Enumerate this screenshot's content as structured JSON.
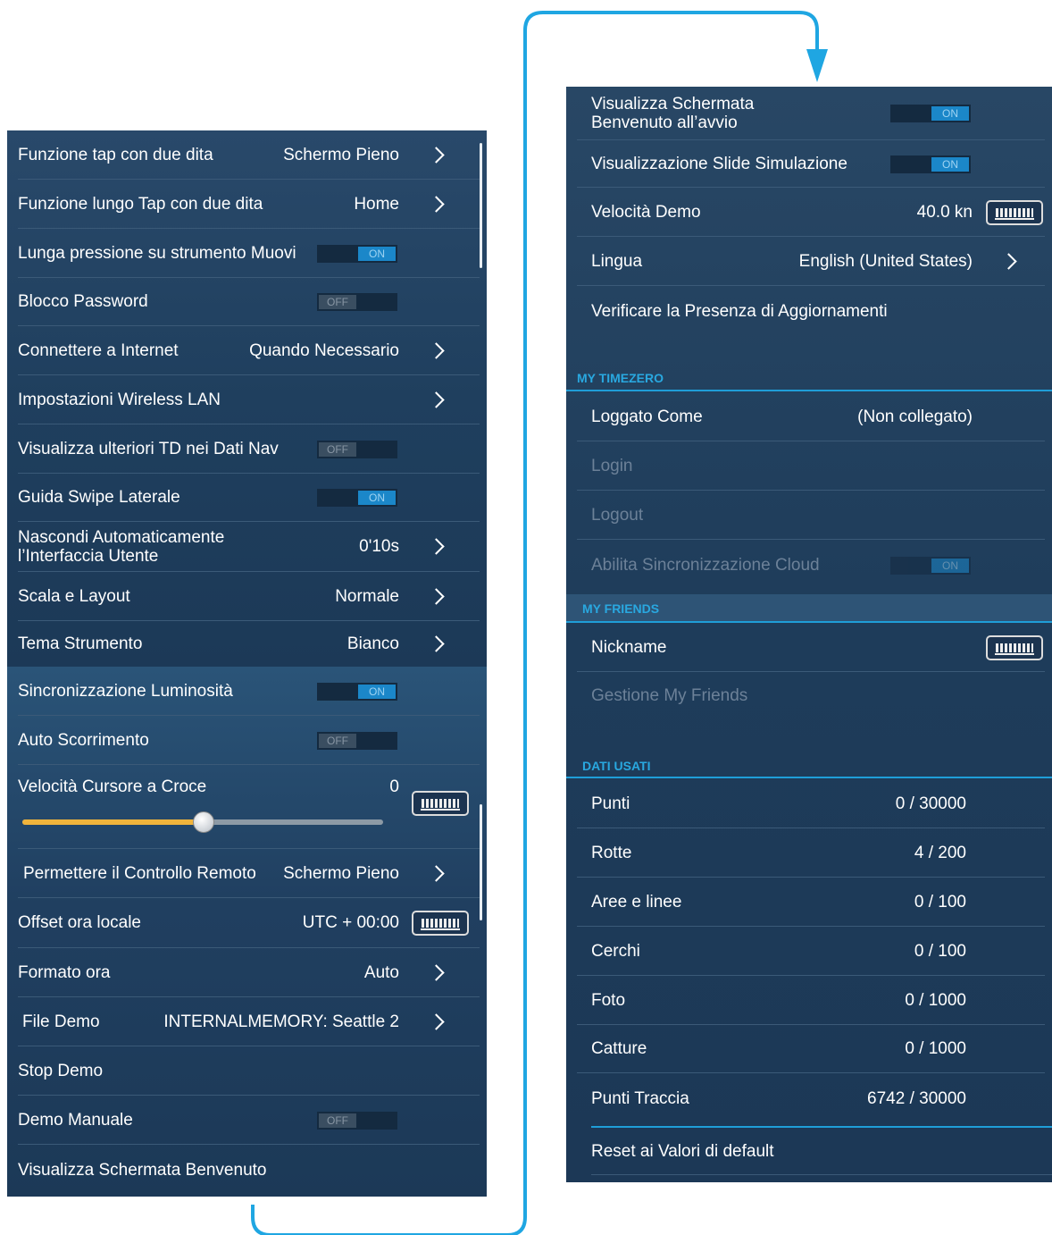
{
  "left_top": [
    {
      "label": "Funzione tap con due dita",
      "value": "Schermo Pieno",
      "chevron": true
    },
    {
      "label": "Funzione lungo Tap con due dita",
      "value": "Home",
      "chevron": true
    },
    {
      "label": "Lunga pressione su strumento Muovi",
      "toggle": "ON"
    },
    {
      "label": "Blocco Password",
      "toggle": "OFF"
    },
    {
      "label": "Connettere a Internet",
      "value": "Quando Necessario",
      "chevron": true
    },
    {
      "label": "Impostazioni Wireless LAN",
      "chevron": true
    },
    {
      "label": "Visualizza ulteriori TD nei Dati Nav",
      "toggle": "OFF"
    },
    {
      "label": "Guida Swipe Laterale",
      "toggle": "ON"
    },
    {
      "label": "Nascondi Automaticamente\nl’Interfaccia Utente",
      "value": "0'10s",
      "chevron": true
    },
    {
      "label": "Scala e Layout",
      "value": "Normale",
      "chevron": true
    },
    {
      "label": "Tema Strumento",
      "value": "Bianco",
      "chevron": true
    }
  ],
  "left_bottom": [
    {
      "label": "Sincronizzazione Luminosità",
      "toggle": "ON"
    },
    {
      "label": "Auto Scorrimento",
      "toggle": "OFF"
    },
    {
      "label": "Velocità Cursore a Croce",
      "value": "0",
      "slider": 0.5,
      "keyboard": true
    },
    {
      "label": "Permettere il Controllo Remoto",
      "value": "Schermo Pieno",
      "chevron": true
    },
    {
      "label": "Offset ora locale",
      "value": "UTC + 00:00",
      "keyboard": true
    },
    {
      "label": "Formato ora",
      "value": "Auto",
      "chevron": true
    },
    {
      "label": "File Demo",
      "value": "INTERNALMEMORY: Seattle 2",
      "chevron": true
    },
    {
      "label": "Stop Demo"
    },
    {
      "label": "Demo Manuale",
      "toggle": "OFF"
    },
    {
      "label": "Visualizza Schermata Benvenuto"
    }
  ],
  "right_top": [
    {
      "label": "Visualizza Schermata\nBenvenuto all’avvio",
      "toggle": "ON"
    },
    {
      "label": "Visualizzazione Slide Simulazione",
      "toggle": "ON"
    },
    {
      "label": "Velocità Demo",
      "value": "40.0 kn",
      "keyboard": true
    },
    {
      "label": "Lingua",
      "value": "English (United States)",
      "chevron": true
    },
    {
      "label": "Verificare la Presenza di Aggiornamenti"
    }
  ],
  "sections": {
    "timezero": "MY TIMEZERO",
    "friends": "MY FRIENDS",
    "dati": "DATI USATI"
  },
  "timezero": [
    {
      "label": "Loggato Come",
      "value": "(Non collegato)"
    },
    {
      "label": "Login",
      "disabled": true
    },
    {
      "label": "Logout",
      "disabled": true
    },
    {
      "label": "Abilita Sincronizzazione Cloud",
      "toggle": "ON",
      "disabled": true
    }
  ],
  "friends": [
    {
      "label": "Nickname",
      "keyboard": true
    },
    {
      "label": "Gestione My Friends",
      "disabled": true
    }
  ],
  "dati": [
    {
      "label": "Punti",
      "value": "0 / 30000"
    },
    {
      "label": "Rotte",
      "value": "4 / 200"
    },
    {
      "label": "Aree e linee",
      "value": "0 / 100"
    },
    {
      "label": "Cerchi",
      "value": "0 / 100"
    },
    {
      "label": "Foto",
      "value": "0 / 1000"
    },
    {
      "label": "Catture",
      "value": "0 / 1000"
    },
    {
      "label": "Punti Traccia",
      "value": "6742 / 30000"
    }
  ],
  "reset": "Reset ai Valori di default",
  "colors": {
    "accent": "#1f9ed8",
    "toggle_on": "#1b87c9",
    "panel": "#1e3d5b"
  }
}
